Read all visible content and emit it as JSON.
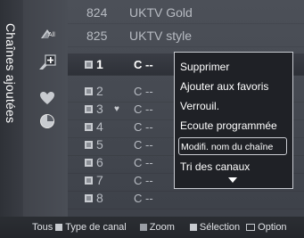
{
  "panel_title": "Chaînes ajoutées",
  "categories": [
    {
      "icon": "all-channels-icon",
      "label": "All"
    },
    {
      "icon": "add-channel-icon",
      "label": ""
    },
    {
      "icon": "favorite-heart-icon",
      "label": ""
    },
    {
      "icon": "scheduled-clock-icon",
      "label": ""
    }
  ],
  "top_rows": [
    {
      "number": "824",
      "name": "UKTV Gold"
    },
    {
      "number": "825",
      "name": "UKTV style"
    }
  ],
  "channels": [
    {
      "number": "1",
      "name": "C --",
      "favorite": false,
      "selected": true
    },
    {
      "number": "2",
      "name": "C --",
      "favorite": false,
      "selected": false
    },
    {
      "number": "3",
      "name": "C --",
      "favorite": true,
      "selected": false
    },
    {
      "number": "4",
      "name": "C --",
      "favorite": false,
      "selected": false
    },
    {
      "number": "5",
      "name": "C --",
      "favorite": false,
      "selected": false
    },
    {
      "number": "6",
      "name": "C --",
      "favorite": false,
      "selected": false
    },
    {
      "number": "7",
      "name": "C --",
      "favorite": false,
      "selected": false
    },
    {
      "number": "8",
      "name": "C --",
      "favorite": false,
      "selected": false
    }
  ],
  "menu": {
    "items": [
      "Supprimer",
      "Ajouter aux favoris",
      "Verrouil.",
      "Ecoute programmée",
      "Modifi. nom du chaîne",
      "Tri des canaux"
    ],
    "highlighted_index": 4
  },
  "footer": {
    "all_label": "Tous",
    "channel_type_label": "Type de canal",
    "zoom_label": "Zoom",
    "select_label": "Sélection",
    "option_label": "Option"
  },
  "colors": {
    "background": "#45494f",
    "popup_bg": "#1f2126",
    "popup_border": "#c9ccd2",
    "text_dim": "#b7bbc2",
    "text_bright": "#ffffff"
  }
}
